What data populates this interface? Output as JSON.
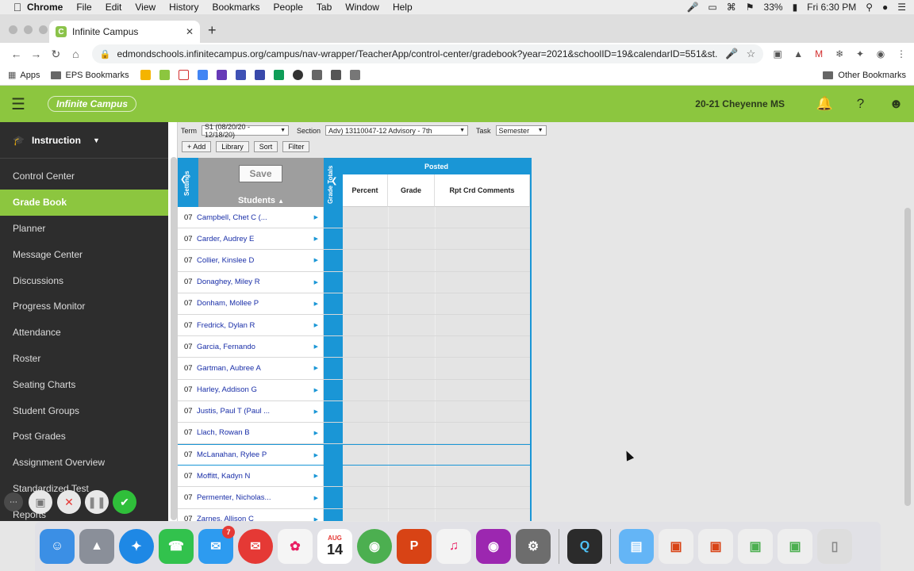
{
  "menubar": {
    "apple": "",
    "items": [
      "Chrome",
      "File",
      "Edit",
      "View",
      "History",
      "Bookmarks",
      "People",
      "Tab",
      "Window",
      "Help"
    ],
    "battery": "33%",
    "clock": "Fri 6:30 PM"
  },
  "browser": {
    "tab_title": "Infinite Campus",
    "url": "edmondschools.infinitecampus.org/campus/nav-wrapper/TeacherApp/control-center/gradebook?year=2021&schoolID=19&calendarID=551&st...",
    "bookmarks": {
      "apps": "Apps",
      "eps": "EPS Bookmarks",
      "other": "Other Bookmarks"
    }
  },
  "header": {
    "logo": "Infinite Campus",
    "school": "20-21 Cheyenne MS"
  },
  "sidebar": {
    "module": "Instruction",
    "items": [
      "Control Center",
      "Grade Book",
      "Planner",
      "Message Center",
      "Discussions",
      "Progress Monitor",
      "Attendance",
      "Roster",
      "Seating Charts",
      "Student Groups",
      "Post Grades",
      "Assignment Overview",
      "Standardized Test",
      "Reports"
    ],
    "active_index": 1
  },
  "filters": {
    "term_label": "Term",
    "term_value": "S1 (08/20/20 - 12/18/20)",
    "section_label": "Section",
    "section_value": "Adv) 13110047-12 Advisory - 7th",
    "task_label": "Task",
    "task_value": "Semester"
  },
  "buttons": {
    "add": "+ Add",
    "library": "Library",
    "sort": "Sort",
    "filter": "Filter",
    "save": "Save"
  },
  "grid": {
    "settings_label": "Settings",
    "students_label": "Students",
    "grade_totals_label": "Grade Totals",
    "posted_label": "Posted",
    "columns": [
      "Percent",
      "Grade",
      "Rpt Crd Comments"
    ],
    "students": [
      {
        "grade": "07",
        "name": "Campbell, Chet C (..."
      },
      {
        "grade": "07",
        "name": "Carder, Audrey E"
      },
      {
        "grade": "07",
        "name": "Collier, Kinslee D"
      },
      {
        "grade": "07",
        "name": "Donaghey, Miley R"
      },
      {
        "grade": "07",
        "name": "Donham, Mollee P"
      },
      {
        "grade": "07",
        "name": "Fredrick, Dylan R"
      },
      {
        "grade": "07",
        "name": "Garcia, Fernando"
      },
      {
        "grade": "07",
        "name": "Gartman, Aubree A"
      },
      {
        "grade": "07",
        "name": "Harley, Addison G"
      },
      {
        "grade": "07",
        "name": "Justis, Paul T (Paul ..."
      },
      {
        "grade": "07",
        "name": "Llach, Rowan B"
      },
      {
        "grade": "07",
        "name": "McLanahan, Rylee P"
      },
      {
        "grade": "07",
        "name": "Moffitt, Kadyn N"
      },
      {
        "grade": "07",
        "name": "Permenter, Nicholas..."
      },
      {
        "grade": "07",
        "name": "Zarnes, Allison C"
      }
    ],
    "selected_index": 11
  },
  "dock": {
    "calendar_month": "AUG",
    "calendar_day": "14",
    "messages_badge": "7"
  },
  "colors": {
    "ic_green": "#8cc63f",
    "ic_blue": "#1a96d6",
    "sidebar_bg": "#2d2d2d"
  }
}
